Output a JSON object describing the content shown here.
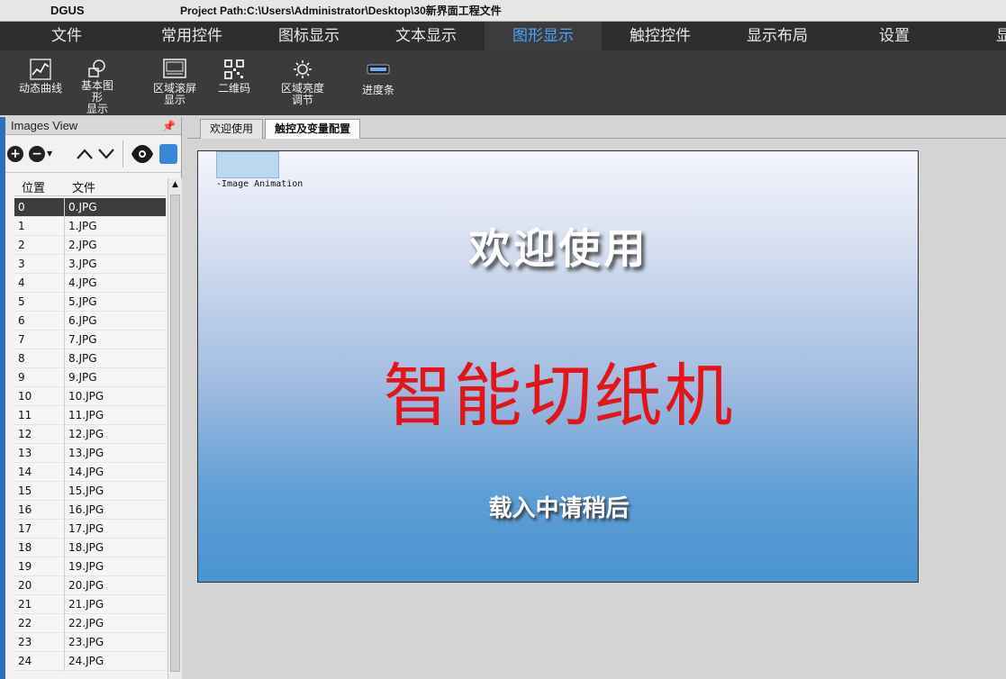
{
  "window": {
    "app_name": "DGUS",
    "project_path": "Project Path:C:\\Users\\Administrator\\Desktop\\30新界面工程文件"
  },
  "menu": {
    "tabs": [
      {
        "label": "文件"
      },
      {
        "label": "常用控件"
      },
      {
        "label": "图标显示"
      },
      {
        "label": "文本显示"
      },
      {
        "label": "图形显示"
      },
      {
        "label": "触控控件"
      },
      {
        "label": "显示布局"
      },
      {
        "label": "设置"
      },
      {
        "label": "显示"
      }
    ],
    "active_color": "#4aa3ff"
  },
  "ribbon": {
    "tools": [
      {
        "label": "动态曲线",
        "icon": "line-chart-icon"
      },
      {
        "label": "基本图形\n显示",
        "icon": "shapes-icon"
      },
      {
        "label": "区域滚屏\n显示",
        "icon": "scroll-area-icon"
      },
      {
        "label": "二维码",
        "icon": "qr-code-icon"
      },
      {
        "label": "区域亮度\n调节",
        "icon": "brightness-icon"
      },
      {
        "label": "进度条",
        "icon": "progress-bar-icon"
      }
    ]
  },
  "images_view": {
    "title": "Images View",
    "pin_glyph": "ᵽ",
    "columns": {
      "pos": "位置",
      "file": "文件"
    },
    "rows": [
      {
        "pos": "0",
        "file": "0.JPG"
      },
      {
        "pos": "1",
        "file": "1.JPG"
      },
      {
        "pos": "2",
        "file": "2.JPG"
      },
      {
        "pos": "3",
        "file": "3.JPG"
      },
      {
        "pos": "4",
        "file": "4.JPG"
      },
      {
        "pos": "5",
        "file": "5.JPG"
      },
      {
        "pos": "6",
        "file": "6.JPG"
      },
      {
        "pos": "7",
        "file": "7.JPG"
      },
      {
        "pos": "8",
        "file": "8.JPG"
      },
      {
        "pos": "9",
        "file": "9.JPG"
      },
      {
        "pos": "10",
        "file": "10.JPG"
      },
      {
        "pos": "11",
        "file": "11.JPG"
      },
      {
        "pos": "12",
        "file": "12.JPG"
      },
      {
        "pos": "13",
        "file": "13.JPG"
      },
      {
        "pos": "14",
        "file": "14.JPG"
      },
      {
        "pos": "15",
        "file": "15.JPG"
      },
      {
        "pos": "16",
        "file": "16.JPG"
      },
      {
        "pos": "17",
        "file": "17.JPG"
      },
      {
        "pos": "18",
        "file": "18.JPG"
      },
      {
        "pos": "19",
        "file": "19.JPG"
      },
      {
        "pos": "20",
        "file": "20.JPG"
      },
      {
        "pos": "21",
        "file": "21.JPG"
      },
      {
        "pos": "22",
        "file": "22.JPG"
      },
      {
        "pos": "23",
        "file": "23.JPG"
      },
      {
        "pos": "24",
        "file": "24.JPG"
      }
    ]
  },
  "doc_tabs": [
    {
      "label": "欢迎使用"
    },
    {
      "label": "触控及变量配置"
    }
  ],
  "canvas": {
    "anim_label": "-Image Animation",
    "welcome_text": "欢迎使用",
    "product_text": "智能切纸机",
    "loading_text": "载入中请稍后",
    "product_color": "#e3141a"
  }
}
